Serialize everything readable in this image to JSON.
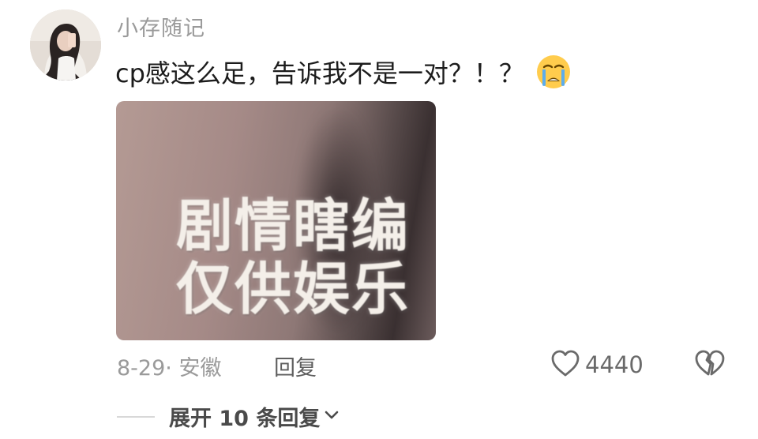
{
  "comment": {
    "username": "小存随记",
    "text": "cp感这么足，告诉我不是一对？！？",
    "emoji": "loudly-crying-face",
    "image_text_line1": "剧情瞎编",
    "image_text_line2": "仅供娱乐",
    "meta": "8-29· 安徽",
    "reply_label": "回复",
    "like_count": "4440",
    "expand_label": "展开 10 条回复"
  },
  "icons": {
    "like": "heart-outline-icon",
    "dislike": "broken-heart-icon",
    "expand": "chevron-down-icon"
  }
}
